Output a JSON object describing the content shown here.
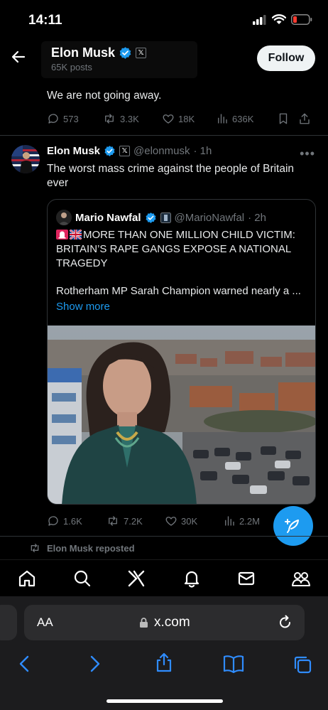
{
  "status_bar": {
    "time": "14:11"
  },
  "header": {
    "name": "Elon Musk",
    "posts": "65K posts",
    "follow_label": "Follow",
    "x_badge": "𝕏"
  },
  "tweet1": {
    "text": "We are not going away.",
    "replies": "573",
    "reposts": "3.3K",
    "likes": "18K",
    "views": "636K"
  },
  "tweet2": {
    "name": "Elon Musk",
    "handle": "@elonmusk",
    "time": "· 1h",
    "x_badge": "𝕏",
    "more": "•••",
    "text": "The worst mass crime against the people of Britain ever",
    "replies": "1.6K",
    "reposts": "7.2K",
    "likes": "30K",
    "views": "2.2M"
  },
  "quote": {
    "name": "Mario Nawfal",
    "handle": "@MarioNawfal",
    "time": "· 2h",
    "headline": "MORE THAN ONE MILLION CHILD VICTIM: BRITAIN’S RAPE GANGS EXPOSE A NATIONAL TRAGEDY",
    "body": "Rotherham MP Sarah Champion warned nearly a ...",
    "show_more": "Show more"
  },
  "repost_banner": "Elon Musk reposted",
  "browser": {
    "aa": "AA",
    "url": "x.com"
  },
  "colors": {
    "accent": "#1d9bf0",
    "muted": "#71767b",
    "background": "#000000"
  },
  "icons": {
    "back": "arrow-left-icon",
    "verified": "verified-badge-icon",
    "reply": "reply-icon",
    "repost": "repost-icon",
    "like": "heart-icon",
    "views": "views-icon",
    "bookmark": "bookmark-icon",
    "share": "share-icon",
    "compose": "compose-icon",
    "tabs": [
      "home-icon",
      "search-icon",
      "grok-icon",
      "bell-icon",
      "mail-icon",
      "communities-icon"
    ]
  }
}
